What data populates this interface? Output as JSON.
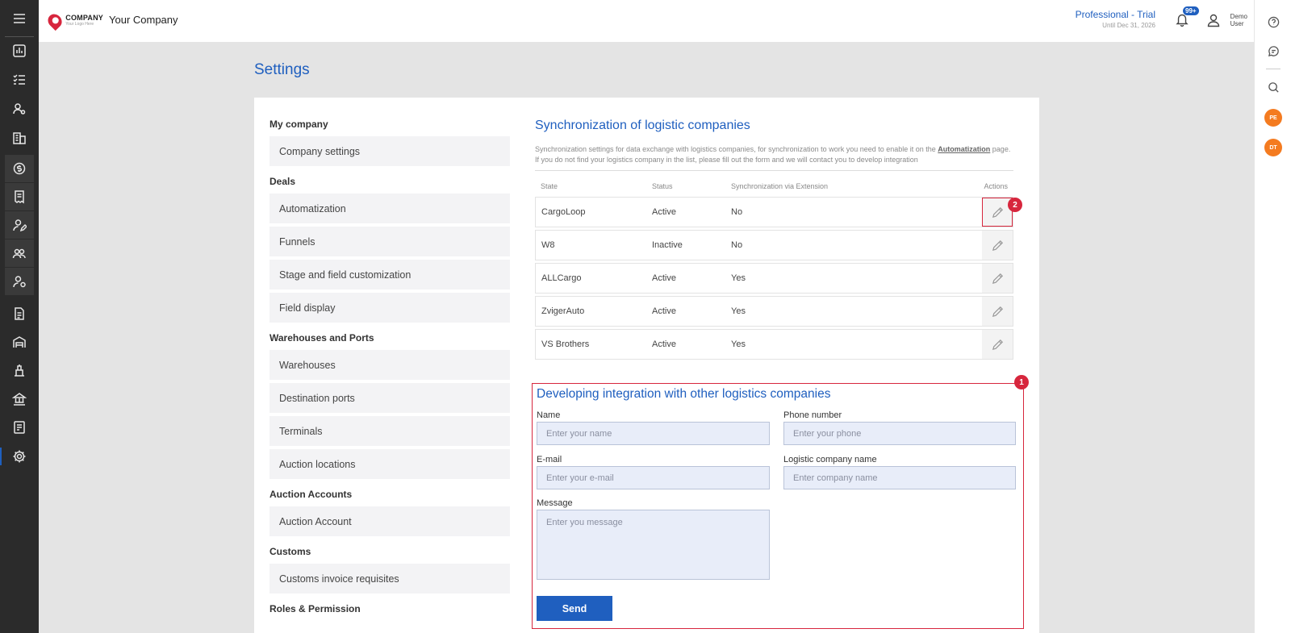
{
  "header": {
    "logo_text": "COMPANY",
    "logo_sub": "Your Logo Here",
    "company_name": "Your Company",
    "plan_name": "Professional - Trial",
    "plan_until": "Until Dec 31, 2026",
    "notifications_badge": "99+",
    "user_first": "Demo",
    "user_last": "User"
  },
  "rightbar": {
    "avatars": [
      "PE",
      "DT"
    ]
  },
  "page": {
    "title": "Settings"
  },
  "menu": {
    "sections": [
      {
        "title": "My company",
        "items": [
          "Company settings"
        ]
      },
      {
        "title": "Deals",
        "items": [
          "Automatization",
          "Funnels",
          "Stage and field customization",
          "Field display"
        ]
      },
      {
        "title": "Warehouses and Ports",
        "items": [
          "Warehouses",
          "Destination ports",
          "Terminals",
          "Auction locations"
        ]
      },
      {
        "title": "Auction Accounts",
        "items": [
          "Auction Account"
        ]
      },
      {
        "title": "Customs",
        "items": [
          "Customs invoice requisites"
        ]
      },
      {
        "title": "Roles & Permission",
        "items": []
      }
    ]
  },
  "sync": {
    "title": "Synchronization of logistic companies",
    "desc_before": "Synchronization settings for data exchange with logistics companies, for synchronization to work you need to enable it on the ",
    "desc_link": "Automatization",
    "desc_after": " page. If you do not find your logistics company in the list, please fill out the form and we will contact you to develop integration",
    "columns": {
      "state": "State",
      "status": "Status",
      "extension": "Synchronization via Extension",
      "actions": "Actions"
    },
    "rows": [
      {
        "state": "CargoLoop",
        "status": "Active",
        "extension": "No"
      },
      {
        "state": "W8",
        "status": "Inactive",
        "extension": "No"
      },
      {
        "state": "ALLCargo",
        "status": "Active",
        "extension": "Yes"
      },
      {
        "state": "ZvigerAuto",
        "status": "Active",
        "extension": "Yes"
      },
      {
        "state": "VS Brothers",
        "status": "Active",
        "extension": "Yes"
      }
    ]
  },
  "form": {
    "title": "Developing integration with other logistics companies",
    "name_label": "Name",
    "name_placeholder": "Enter your name",
    "phone_label": "Phone number",
    "phone_placeholder": "Enter your phone",
    "email_label": "E-mail",
    "email_placeholder": "Enter your e-mail",
    "company_label": "Logistic company name",
    "company_placeholder": "Enter company name",
    "message_label": "Message",
    "message_placeholder": "Enter you message",
    "send_label": "Send"
  },
  "markers": {
    "form": "1",
    "edit": "2"
  },
  "colors": {
    "accent": "#1f5fbf",
    "highlight": "#d7263d",
    "sidebar": "#2b2b2b"
  }
}
